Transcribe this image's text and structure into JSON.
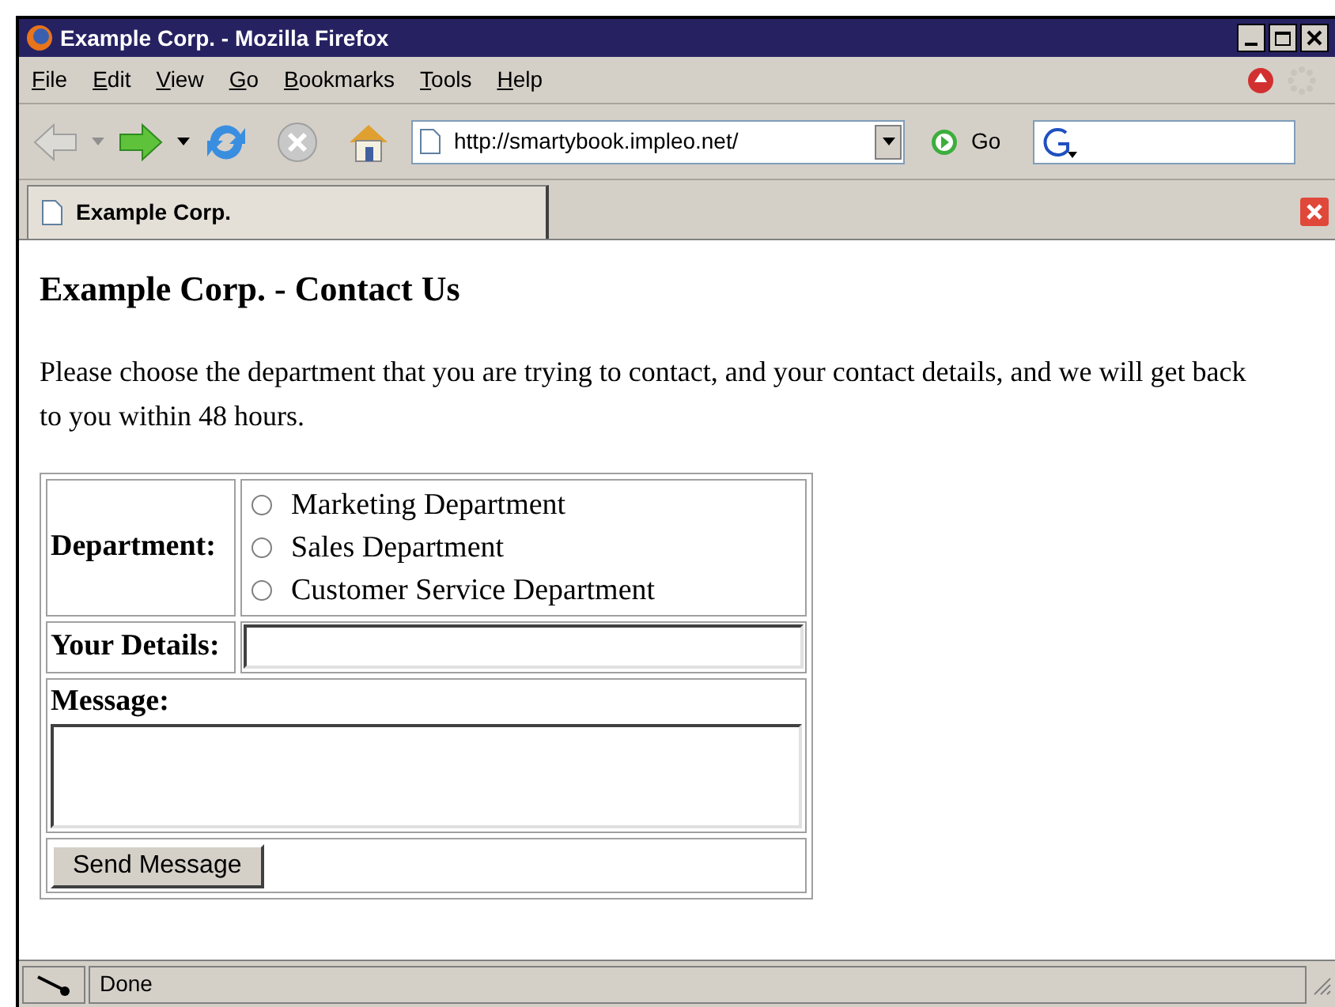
{
  "window": {
    "title": "Example Corp. - Mozilla Firefox"
  },
  "menu": [
    "File",
    "Edit",
    "View",
    "Go",
    "Bookmarks",
    "Tools",
    "Help"
  ],
  "address_bar": {
    "value": "http://smartybook.impleo.net/"
  },
  "go_button": "Go",
  "tabs": [
    {
      "label": "Example Corp.",
      "selected": true
    }
  ],
  "page": {
    "heading": "Example Corp. - Contact Us",
    "intro": "Please choose the department that you are trying to contact, and your contact details, and we will get back to you within 48 hours.",
    "form": {
      "department_label": "Department:",
      "departments": [
        {
          "label": "Marketing Department",
          "selected": false
        },
        {
          "label": "Sales Department",
          "selected": false
        },
        {
          "label": "Customer Service Department",
          "selected": false
        }
      ],
      "details_label": "Your Details:",
      "message_label": "Message:",
      "submit": "Send Message"
    }
  },
  "status_bar": {
    "text": "Done"
  }
}
